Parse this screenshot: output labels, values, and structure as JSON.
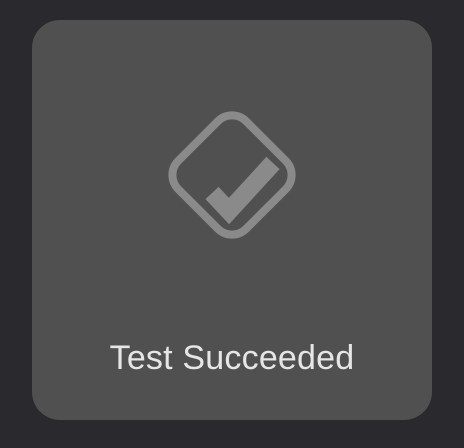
{
  "hud": {
    "icon": "checkmark-diamond-icon",
    "message": "Test Succeeded",
    "colors": {
      "background": "#2a2a2e",
      "panel": "#505050",
      "icon": "#8a8a8a",
      "text": "#e6e6e6"
    }
  }
}
